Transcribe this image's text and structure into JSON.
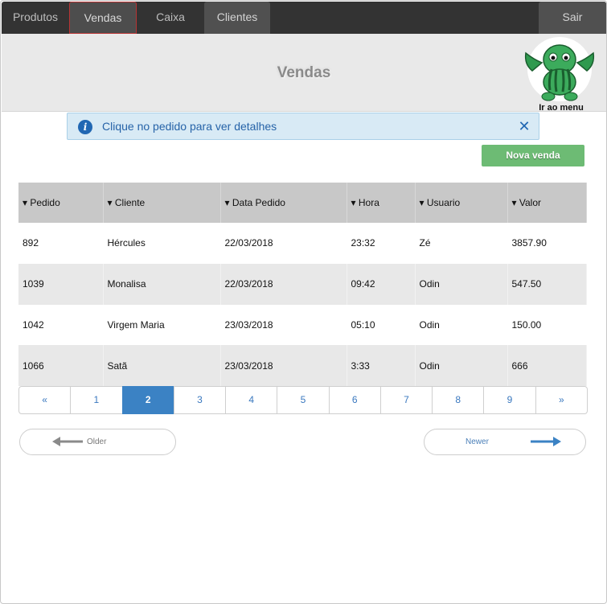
{
  "nav": {
    "tabs": [
      {
        "label": "Produtos"
      },
      {
        "label": "Vendas"
      },
      {
        "label": "Caixa"
      },
      {
        "label": "Clientes"
      }
    ],
    "logout": "Sair"
  },
  "header": {
    "title": "Vendas",
    "menu_link": "Ir ao menu"
  },
  "alert": {
    "message": "Clique no pedido para ver detalhes",
    "icon": "info-icon",
    "close_icon": "close-icon"
  },
  "toolbar": {
    "new_sale": "Nova venda"
  },
  "table": {
    "sort_marker": "▾",
    "columns": [
      "Pedido",
      "Cliente",
      "Data Pedido",
      "Hora",
      "Usuario",
      "Valor"
    ],
    "rows": [
      [
        "892",
        "Hércules",
        "22/03/2018",
        "23:32",
        "Zé",
        "3857.90"
      ],
      [
        "1039",
        "Monalisa",
        "22/03/2018",
        "09:42",
        "Odin",
        "547.50"
      ],
      [
        "1042",
        "Virgem Maria",
        "23/03/2018",
        "05:10",
        "Odin",
        "150.00"
      ],
      [
        "1066",
        "Satã",
        "23/03/2018",
        "3:33",
        "Odin",
        "666"
      ]
    ]
  },
  "pager": {
    "pages": [
      "«",
      "1",
      "2",
      "3",
      "4",
      "5",
      "6",
      "7",
      "8",
      "9",
      "»"
    ],
    "current": "2"
  },
  "footer_nav": {
    "older": "Older",
    "newer": "Newer"
  },
  "colors": {
    "accent": "#3b82c4",
    "primary_button": "#6dbb74",
    "nav_bg": "#333333",
    "alert_bg": "#d8eaf5"
  }
}
